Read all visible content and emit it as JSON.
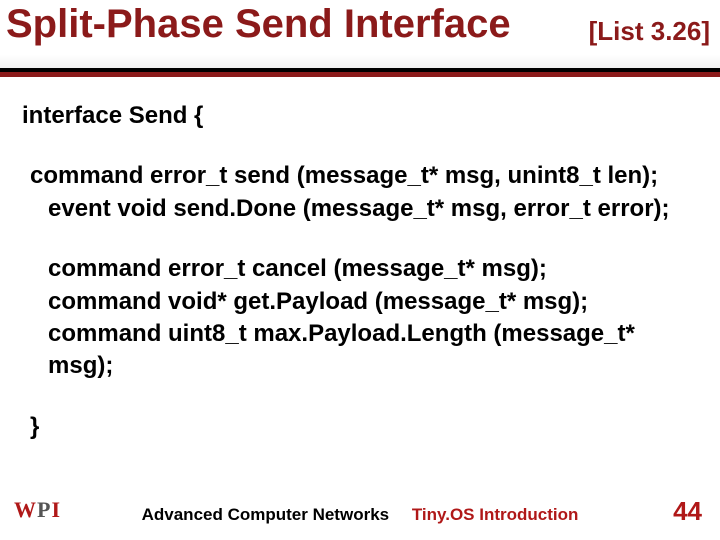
{
  "title": "Split-Phase Send Interface",
  "title_tag": "[List 3.26]",
  "code": {
    "l1": "interface Send {",
    "l2": "command error_t send (message_t* msg, unint8_t len);",
    "l3": "event void send.Done (message_t* msg, error_t error);",
    "l4": "command error_t   cancel (message_t* msg);",
    "l5": "command void* get.Payload (message_t* msg);",
    "l6": "command uint8_t max.Payload.Length (message_t* msg);",
    "l7": "}"
  },
  "footer": {
    "course": "Advanced Computer Networks",
    "topic": "Tiny.OS Introduction",
    "page": "44",
    "logo_w": "W",
    "logo_p": "P",
    "logo_i": "I"
  }
}
